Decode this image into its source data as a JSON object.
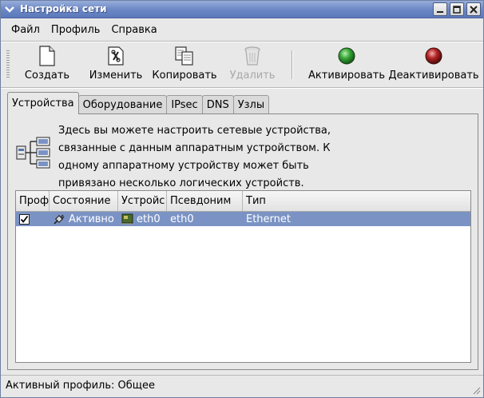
{
  "window": {
    "title": "Настройка сети"
  },
  "menubar": {
    "items": [
      {
        "label": "Файл"
      },
      {
        "label": "Профиль"
      },
      {
        "label": "Справка"
      }
    ]
  },
  "toolbar": {
    "create": "Создать",
    "edit": "Изменить",
    "copy": "Копировать",
    "delete": "Удалить",
    "activate": "Активировать",
    "deactivate": "Деактивировать"
  },
  "tabs": [
    {
      "label": "Устройства"
    },
    {
      "label": "Оборудование"
    },
    {
      "label": "IPsec"
    },
    {
      "label": "DNS"
    },
    {
      "label": "Узлы"
    }
  ],
  "devices": {
    "description": [
      "Здесь вы можете настроить сетевые устройства,",
      "связанные с данным аппаратным устройством. К",
      "одному аппаратному устройству может быть",
      "привязано несколько логических устройств."
    ],
    "columns": [
      "Проф",
      "Состояние",
      "Устройс",
      "Псевдоним",
      "Тип"
    ],
    "rows": [
      {
        "profile_checked": true,
        "status": "Активно",
        "device": "eth0",
        "alias": "eth0",
        "type": "Ethernet"
      }
    ]
  },
  "statusbar": {
    "text": "Активный профиль: Общее"
  },
  "colors": {
    "titlebar": "#6a86c4",
    "selection": "#7b93c4",
    "activate_led": "#2e9a2e",
    "deactivate_led": "#b02020"
  }
}
